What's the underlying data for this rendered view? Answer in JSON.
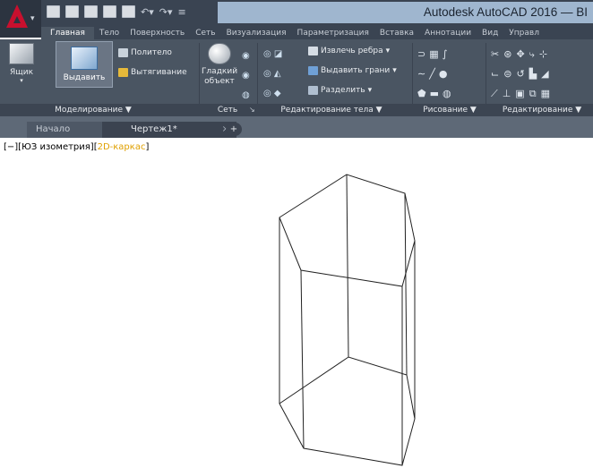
{
  "title": "Autodesk AutoCAD 2016 — BI",
  "ribbon_tabs": [
    "Главная",
    "Тело",
    "Поверхность",
    "Сеть",
    "Визуализация",
    "Параметризация",
    "Вставка",
    "Аннотации",
    "Вид",
    "Управл"
  ],
  "modeling": {
    "box_label": "Ящик",
    "extrude_label": "Выдавить",
    "polysolid_label": "Политело",
    "presspull_label": "Вытягивание",
    "panel_title": "Моделирование ▼"
  },
  "mesh": {
    "smooth_label_1": "Гладкий",
    "smooth_label_2": "объект",
    "panel_title": "Сеть"
  },
  "solid_edit": {
    "extract_edges_label": "Извлечь ребра",
    "extrude_faces_label": "Выдавить грани",
    "separate_label": "Разделить",
    "panel_title": "Редактирование тела ▼"
  },
  "draw": {
    "panel_title": "Рисование ▼"
  },
  "modify": {
    "panel_title": "Редактирование ▼"
  },
  "doc_tabs": {
    "start": "Начало",
    "current": "Чертеж1*",
    "close": "×",
    "new": "+"
  },
  "viewport": {
    "control": "[−][ЮЗ изометрия][",
    "style": "2D-каркас",
    "end": "]"
  },
  "colors": {
    "accent_red": "#c8102e",
    "visual_style_label": "#e0a000",
    "ribbon_bg": "#4a5562"
  }
}
